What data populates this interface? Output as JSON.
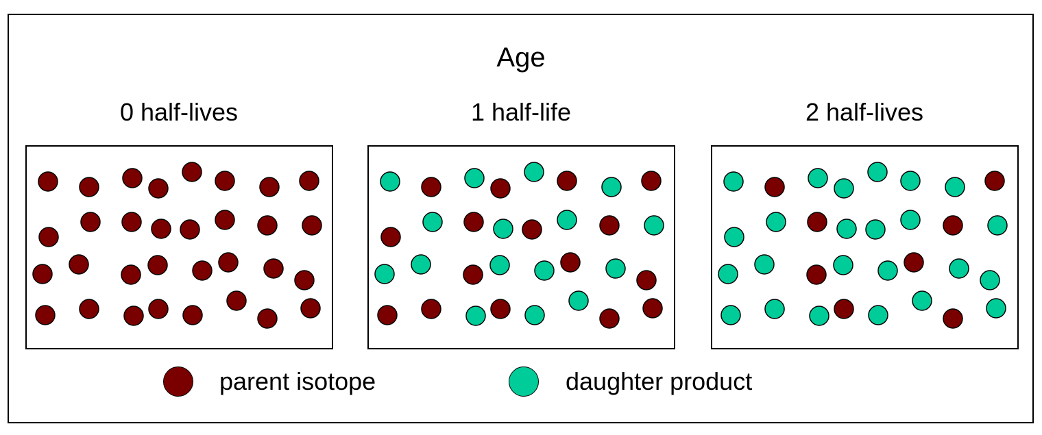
{
  "title": "Age",
  "colors": {
    "parent": "#7a0000",
    "daughter": "#00cc99"
  },
  "legend": [
    {
      "key": "parent",
      "label": "parent isotope"
    },
    {
      "key": "daughter",
      "label": "daughter product"
    }
  ],
  "panels": [
    {
      "label": "0 half-lives",
      "particles": [
        "P",
        "P",
        "P",
        "P",
        "P",
        "P",
        "P",
        "P",
        "P",
        "P",
        "P",
        "P",
        "P",
        "P",
        "P",
        "P",
        "P",
        "P",
        "P",
        "P",
        "P",
        "P",
        "P",
        "P",
        "P",
        "P",
        "P",
        "P",
        "P",
        "P",
        "P",
        "P"
      ]
    },
    {
      "label": "1 half-life",
      "particles": [
        "D",
        "P",
        "D",
        "P",
        "D",
        "P",
        "D",
        "P",
        "P",
        "D",
        "P",
        "D",
        "P",
        "D",
        "P",
        "D",
        "D",
        "D",
        "P",
        "D",
        "D",
        "P",
        "D",
        "P",
        "P",
        "P",
        "D",
        "P",
        "D",
        "D",
        "P",
        "P"
      ]
    },
    {
      "label": "2 half-lives",
      "particles": [
        "D",
        "P",
        "D",
        "D",
        "D",
        "D",
        "D",
        "P",
        "D",
        "D",
        "P",
        "D",
        "D",
        "D",
        "P",
        "D",
        "D",
        "D",
        "P",
        "D",
        "D",
        "P",
        "D",
        "D",
        "D",
        "D",
        "D",
        "P",
        "D",
        "D",
        "P",
        "D"
      ]
    }
  ]
}
